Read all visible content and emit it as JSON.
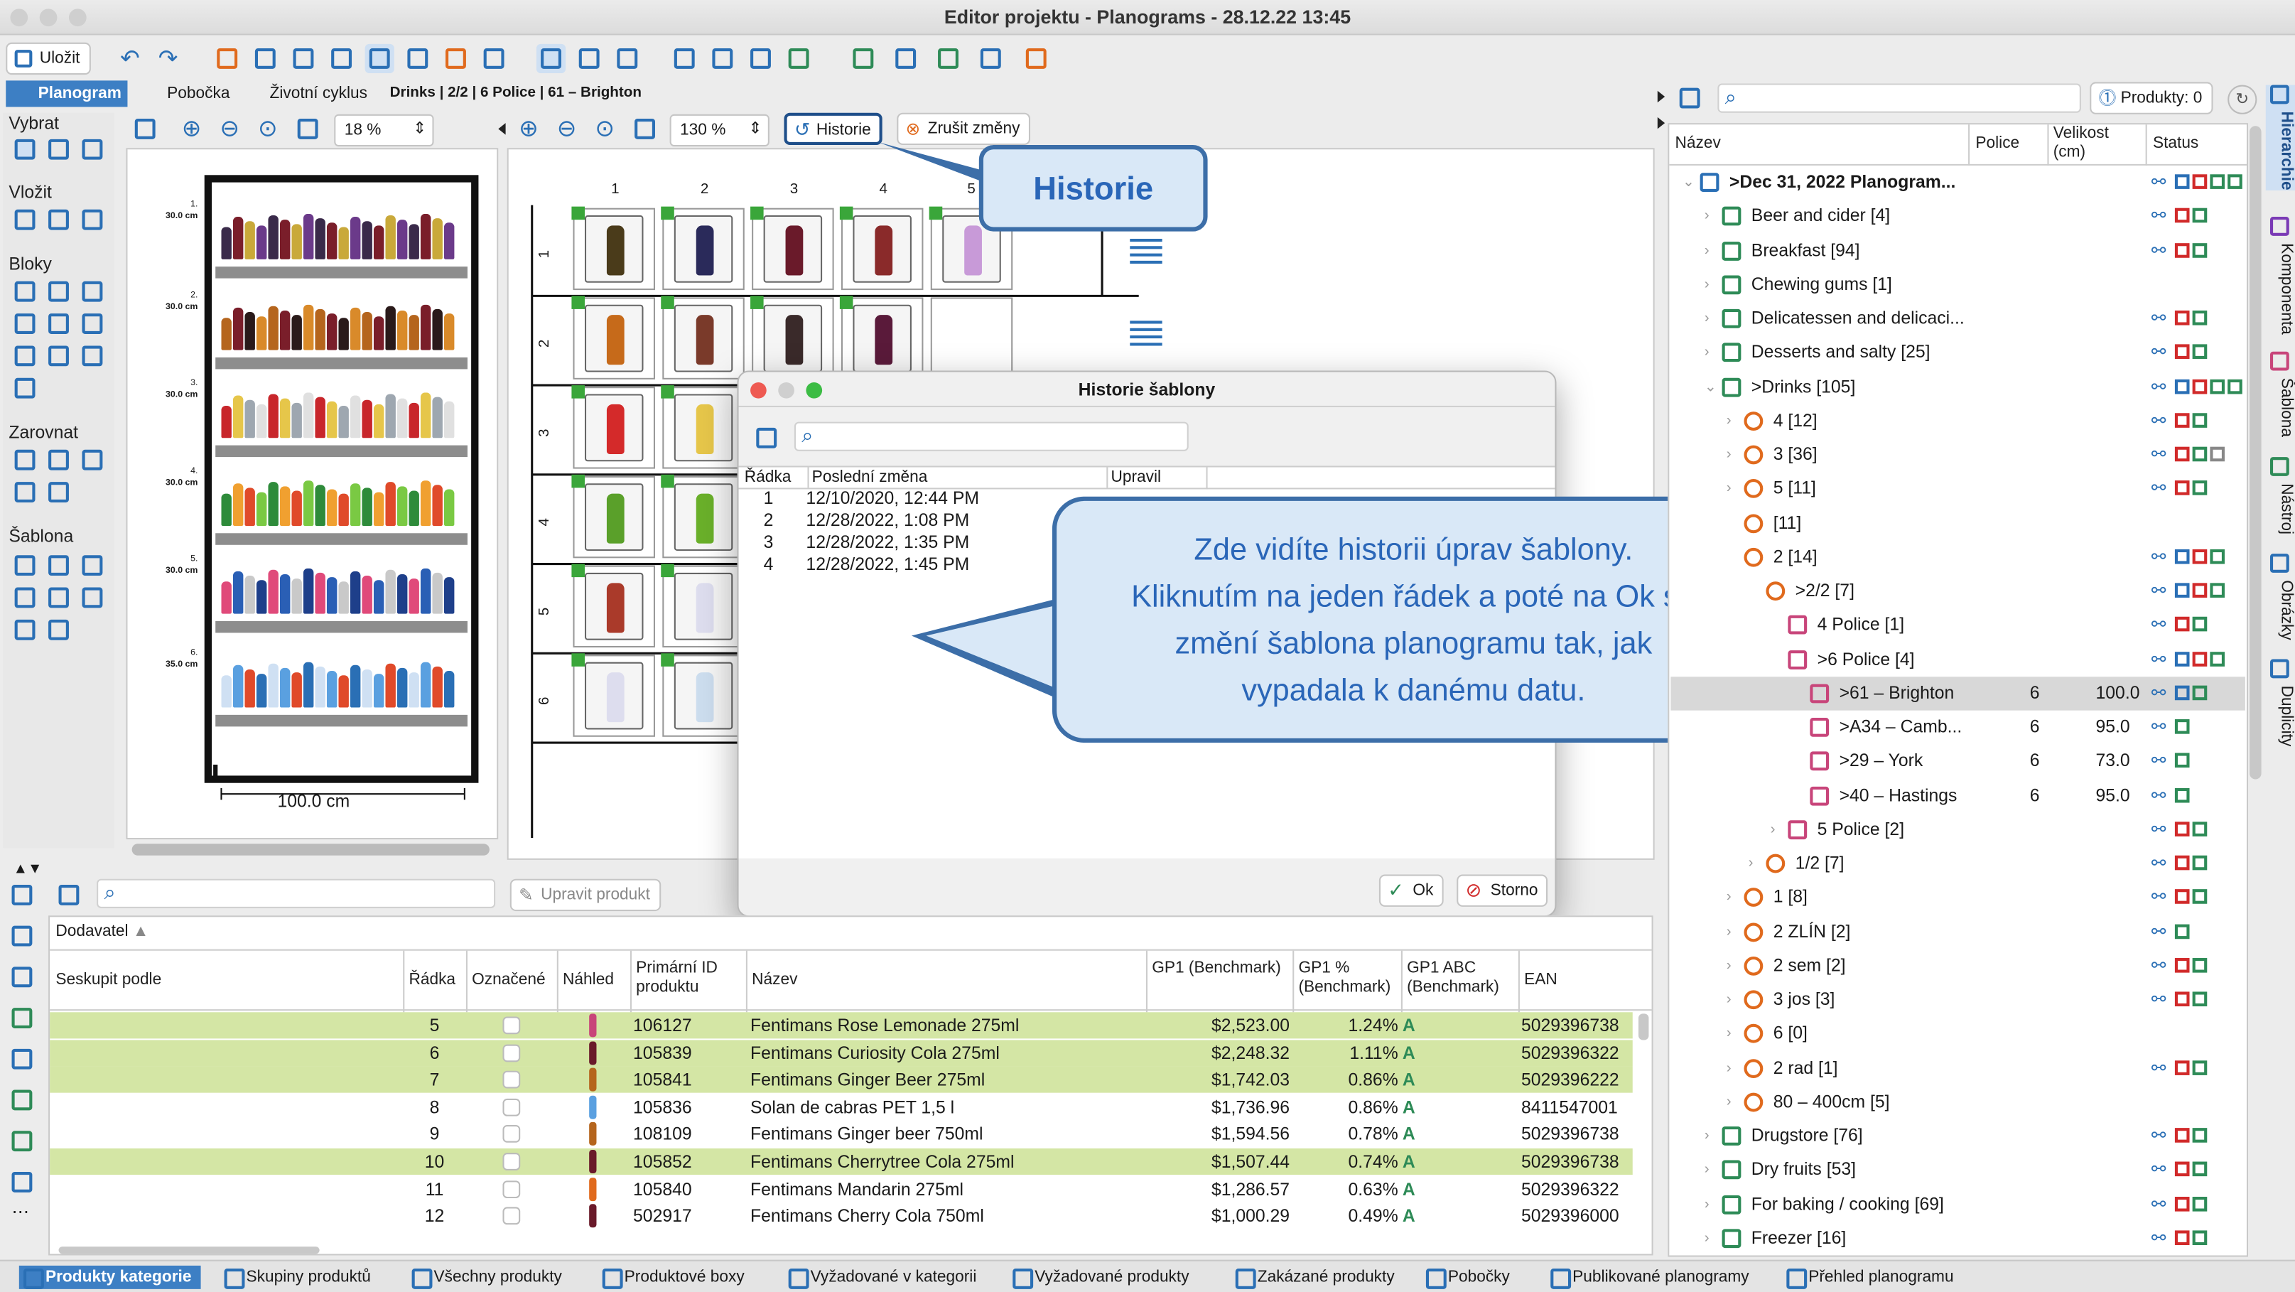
{
  "window": {
    "title": "Editor projektu - Planograms - 28.12.22 13:45",
    "save": "Uložit"
  },
  "tabs": [
    "Planogram",
    "Pobočka",
    "Životní cyklus"
  ],
  "breadcrumb": "Drinks | 2/2 | 6 Police | 61 – Brighton",
  "left_sections": {
    "select": "Vybrat",
    "insert": "Vložit",
    "blocks": "Bloky",
    "align": "Zarovnat",
    "template": "Šablona"
  },
  "zoom_left": "18 %",
  "zoom_mid": "130 %",
  "history_btn": "Historie",
  "cancel_changes_btn": "Zrušit změny",
  "callout_history": "Historie",
  "planogram": {
    "width_label": "100.0 cm",
    "shelves": [
      {
        "num": "1.",
        "h": "30.0 cm"
      },
      {
        "num": "2.",
        "h": "30.0 cm"
      },
      {
        "num": "3.",
        "h": "30.0 cm"
      },
      {
        "num": "4.",
        "h": "30.0 cm"
      },
      {
        "num": "5.",
        "h": "30.0 cm"
      },
      {
        "num": "6.",
        "h": "35.0 cm"
      }
    ],
    "cols": [
      "1",
      "2",
      "3",
      "4",
      "5"
    ],
    "rows": [
      "1",
      "2",
      "3",
      "4",
      "5",
      "6"
    ]
  },
  "dialog": {
    "title": "Historie šablony",
    "cols": [
      "Řádka",
      "Poslední změna",
      "Upravil"
    ],
    "rows": [
      {
        "n": "1",
        "d": "12/10/2020, 12:44 PM"
      },
      {
        "n": "2",
        "d": "12/28/2022, 1:08 PM"
      },
      {
        "n": "3",
        "d": "12/28/2022, 1:35 PM"
      },
      {
        "n": "4",
        "d": "12/28/2022, 1:45 PM"
      }
    ],
    "ok": "Ok",
    "cancel": "Storno"
  },
  "callout_info": {
    "l1": "Zde vidíte historii úprav šablony.",
    "l2": "Kliknutím na jeden řádek a poté na Ok se",
    "l3": "změní šablona planogramu tak, jak",
    "l4": "vypadala k danému datu."
  },
  "right_panel": {
    "products_btn": "Produkty: 0",
    "cols": {
      "name": "Název",
      "shelf": "Police",
      "size": "Velikost (cm)",
      "status": "Status"
    },
    "tree": [
      {
        "l": ">Dec 31, 2022 Planogram...",
        "ind": 0,
        "b": true,
        "s": "",
        "v": ""
      },
      {
        "l": "Beer and cider [4]",
        "ind": 1,
        "s": "",
        "v": ""
      },
      {
        "l": "Breakfast [94]",
        "ind": 1,
        "s": "",
        "v": ""
      },
      {
        "l": "Chewing gums [1]",
        "ind": 1,
        "s": "",
        "v": ""
      },
      {
        "l": "Delicatessen and delicaci...",
        "ind": 1,
        "s": "",
        "v": ""
      },
      {
        "l": "Desserts and salty [25]",
        "ind": 1,
        "s": "",
        "v": ""
      },
      {
        "l": ">Drinks [105]",
        "ind": 1,
        "s": "",
        "v": ""
      },
      {
        "l": "4 [12]",
        "ind": 2,
        "s": "",
        "v": ""
      },
      {
        "l": "3 [36]",
        "ind": 2,
        "s": "",
        "v": ""
      },
      {
        "l": "5 [11]",
        "ind": 2,
        "s": "",
        "v": ""
      },
      {
        "l": "[11]",
        "ind": 2,
        "s": "",
        "v": ""
      },
      {
        "l": "2 [14]",
        "ind": 2,
        "s": "",
        "v": ""
      },
      {
        "l": ">2/2 [7]",
        "ind": 3,
        "s": "",
        "v": ""
      },
      {
        "l": "4 Police [1]",
        "ind": 4,
        "s": "",
        "v": ""
      },
      {
        "l": ">6 Police [4]",
        "ind": 4,
        "s": "",
        "v": ""
      },
      {
        "l": ">61 – Brighton",
        "ind": 5,
        "s": "6",
        "v": "100.0",
        "sel": true
      },
      {
        "l": ">A34 – Camb...",
        "ind": 5,
        "s": "6",
        "v": "95.0"
      },
      {
        "l": ">29 – York",
        "ind": 5,
        "s": "6",
        "v": "73.0"
      },
      {
        "l": ">40 – Hastings",
        "ind": 5,
        "s": "6",
        "v": "95.0"
      },
      {
        "l": "5 Police [2]",
        "ind": 4,
        "s": "",
        "v": ""
      },
      {
        "l": "1/2 [7]",
        "ind": 3,
        "s": "",
        "v": ""
      },
      {
        "l": "1 [8]",
        "ind": 2,
        "s": "",
        "v": ""
      },
      {
        "l": "2 ZLÍN [2]",
        "ind": 2,
        "s": "",
        "v": ""
      },
      {
        "l": "2 sem [2]",
        "ind": 2,
        "s": "",
        "v": ""
      },
      {
        "l": "3 jos [3]",
        "ind": 2,
        "s": "",
        "v": ""
      },
      {
        "l": "6 [0]",
        "ind": 2,
        "s": "",
        "v": ""
      },
      {
        "l": "2 rad [1]",
        "ind": 2,
        "s": "",
        "v": ""
      },
      {
        "l": "80 – 400cm [5]",
        "ind": 2,
        "s": "",
        "v": ""
      },
      {
        "l": "Drugstore [76]",
        "ind": 1,
        "s": "",
        "v": ""
      },
      {
        "l": "Dry fruits [53]",
        "ind": 1,
        "s": "",
        "v": ""
      },
      {
        "l": "For baking / cooking [69]",
        "ind": 1,
        "s": "",
        "v": ""
      },
      {
        "l": "Freezer [16]",
        "ind": 1,
        "s": "",
        "v": ""
      }
    ]
  },
  "vtabs": [
    "Hierarchie",
    "Komponenta",
    "Šablona",
    "Nástroj",
    "Obrázky",
    "Duplicity"
  ],
  "bottom": {
    "edit_product": "Upravit produkt",
    "group_label": "Dodavatel",
    "cols": [
      "Seskupit podle",
      "Řádka",
      "Označené",
      "Náhled",
      "Primární ID produktu",
      "Název",
      "GP1 (Benchmark)",
      "GP1 % (Benchmark)",
      "GP1 ABC (Benchmark)",
      "EAN"
    ],
    "rows": [
      {
        "r": "5",
        "id": "106127",
        "n": "Fentimans Rose Lemonade 275ml",
        "gp": "$2,523.00",
        "pct": "1.24%",
        "abc": "A",
        "ean": "5029396738",
        "hl": true
      },
      {
        "r": "6",
        "id": "105839",
        "n": "Fentimans Curiosity Cola 275ml",
        "gp": "$2,248.32",
        "pct": "1.11%",
        "abc": "A",
        "ean": "5029396322",
        "hl": true
      },
      {
        "r": "7",
        "id": "105841",
        "n": "Fentimans Ginger Beer 275ml",
        "gp": "$1,742.03",
        "pct": "0.86%",
        "abc": "A",
        "ean": "5029396222",
        "hl": true
      },
      {
        "r": "8",
        "id": "105836",
        "n": "Solan de cabras PET 1,5 l",
        "gp": "$1,736.96",
        "pct": "0.86%",
        "abc": "A",
        "ean": "8411547001",
        "hl": false
      },
      {
        "r": "9",
        "id": "108109",
        "n": "Fentimans Ginger beer 750ml",
        "gp": "$1,594.56",
        "pct": "0.78%",
        "abc": "A",
        "ean": "5029396738",
        "hl": false
      },
      {
        "r": "10",
        "id": "105852",
        "n": "Fentimans Cherrytree Cola 275ml",
        "gp": "$1,507.44",
        "pct": "0.74%",
        "abc": "A",
        "ean": "5029396738",
        "hl": true
      },
      {
        "r": "11",
        "id": "105840",
        "n": "Fentimans Mandarin 275ml",
        "gp": "$1,286.57",
        "pct": "0.63%",
        "abc": "A",
        "ean": "5029396322",
        "hl": false
      },
      {
        "r": "12",
        "id": "502917",
        "n": "Fentimans Cherry Cola 750ml",
        "gp": "$1,000.29",
        "pct": "0.49%",
        "abc": "A",
        "ean": "5029396000",
        "hl": false
      }
    ]
  },
  "status_tabs": [
    "Produkty kategorie",
    "Skupiny produktů",
    "Všechny produkty",
    "Produktové boxy",
    "Vyžadované v kategorii",
    "Vyžadované produkty",
    "Zakázané produkty",
    "Pobočky",
    "Publikované planogramy",
    "Přehled planogramu"
  ],
  "colors": {
    "accent": "#3d7fc4",
    "highlight": "#d4e6a5",
    "callout_border": "#3c6ea8"
  }
}
